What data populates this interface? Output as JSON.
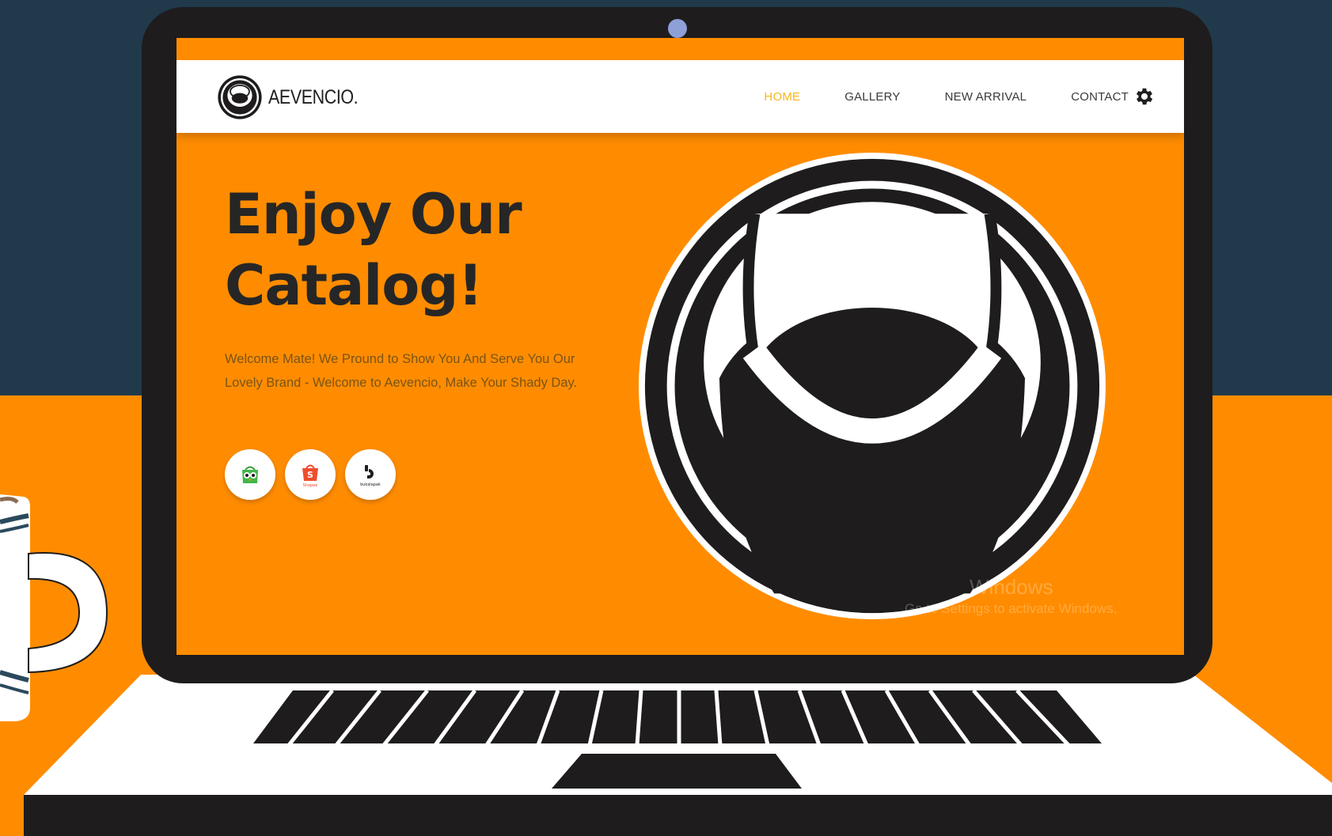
{
  "site": {
    "brand_name": "AEVENCIO.",
    "nav": [
      {
        "label": "HOME",
        "active": true
      },
      {
        "label": "GALLERY",
        "active": false
      },
      {
        "label": "NEW ARRIVAL",
        "active": false
      },
      {
        "label": "CONTACT",
        "active": false
      }
    ],
    "settings_icon": "gear-icon"
  },
  "hero": {
    "title_line1": "Enjoy Our",
    "title_line2": "Catalog!",
    "description": "Welcome Mate! We Pround to Show You And Serve You Our Lovely Brand - Welcome to Aevencio, Make Your Shady Day.",
    "stores": [
      {
        "icon": "tokopedia-icon",
        "caption": ""
      },
      {
        "icon": "shopee-icon",
        "caption": "Shopee"
      },
      {
        "icon": "bukalapak-icon",
        "caption": "bukalapak"
      }
    ]
  },
  "watermark": {
    "line1": "Windows",
    "line2": "Go to Settings to activate Windows."
  },
  "colors": {
    "orange": "#ff8c00",
    "navy": "#203a4c",
    "dark": "#1e1c1d",
    "accent_nav": "#f7b718"
  }
}
